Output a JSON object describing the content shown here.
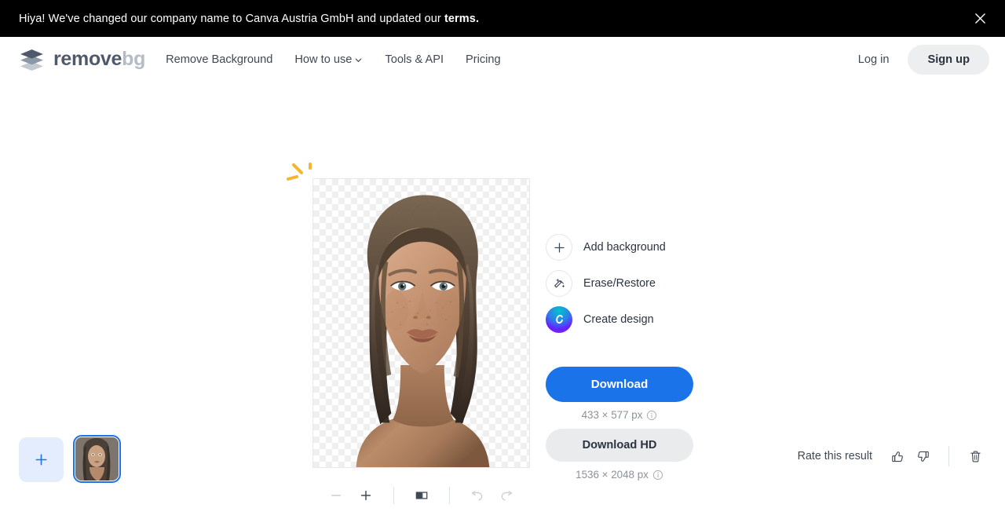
{
  "banner": {
    "message_prefix": "Hiya! We've changed our company name to Canva Austria GmbH and updated our ",
    "message_link": "terms.",
    "close_icon": "close-icon"
  },
  "header": {
    "logo": {
      "primary": "remove",
      "secondary": "bg"
    },
    "nav": [
      {
        "label": "Remove Background",
        "has_chevron": false
      },
      {
        "label": "How to use",
        "has_chevron": true
      },
      {
        "label": "Tools & API",
        "has_chevron": false
      },
      {
        "label": "Pricing",
        "has_chevron": false
      }
    ],
    "login_label": "Log in",
    "signup_label": "Sign up"
  },
  "editor": {
    "toolbar": [
      {
        "name": "zoom-out-button",
        "icon": "minus-icon",
        "state": "disabled"
      },
      {
        "name": "zoom-in-button",
        "icon": "plus-icon",
        "state": "enabled"
      },
      {
        "name": "compare-toggle-button",
        "icon": "compare-icon",
        "state": "enabled"
      },
      {
        "name": "undo-button",
        "icon": "undo-icon",
        "state": "disabled"
      },
      {
        "name": "redo-button",
        "icon": "redo-icon",
        "state": "disabled"
      }
    ]
  },
  "actions": [
    {
      "label": "Add background",
      "icon": "plus-icon"
    },
    {
      "label": "Erase/Restore",
      "icon": "magic-wand-icon"
    },
    {
      "label": "Create design",
      "icon": "canva-logo-icon"
    }
  ],
  "download": {
    "primary_label": "Download",
    "primary_dimensions": "433 × 577 px",
    "hd_label": "Download HD",
    "hd_dimensions": "1536 × 2048 px",
    "info_icon": "info-icon"
  },
  "bottom": {
    "add_image_icon": "plus-icon",
    "rate_label": "Rate this result",
    "thumbs_up_icon": "thumbs-up-icon",
    "thumbs_down_icon": "thumbs-down-icon",
    "delete_icon": "trash-icon"
  },
  "colors": {
    "accent_blue": "#1a73e8",
    "banner_bg": "#000000",
    "button_gray": "#e9ebed",
    "logo_dark": "#4e5a6b",
    "logo_light": "#b4bcc6",
    "confetti_yellow": "#f5b62e"
  }
}
